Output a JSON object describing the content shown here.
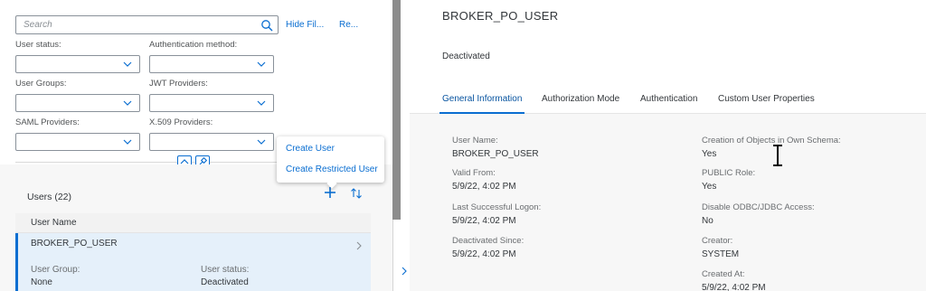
{
  "filter": {
    "search_placeholder": "Search",
    "hide_filters": "Hide Fil...",
    "restore": "Re...",
    "fields": [
      {
        "label": "User status:",
        "value": ""
      },
      {
        "label": "Authentication method:",
        "value": ""
      },
      {
        "label": "User Groups:",
        "value": ""
      },
      {
        "label": "JWT Providers:",
        "value": ""
      },
      {
        "label": "SAML Providers:",
        "value": ""
      },
      {
        "label": "X.509 Providers:",
        "value": ""
      }
    ]
  },
  "popover": {
    "items": [
      "Create User",
      "Create Restricted User"
    ]
  },
  "list": {
    "title": "Users (22)",
    "column_header": "User Name",
    "rows": [
      {
        "name": "BROKER_PO_USER",
        "group_label": "User Group:",
        "group_value": "None",
        "status_label": "User status:",
        "status_value": "Deactivated"
      }
    ]
  },
  "detail": {
    "title": "BROKER_PO_USER",
    "status": "Deactivated",
    "tabs": [
      "General Information",
      "Authorization Mode",
      "Authentication",
      "Custom User Properties"
    ],
    "active_tab": "General Information",
    "left_fields": [
      {
        "label": "User Name:",
        "value": "BROKER_PO_USER"
      },
      {
        "label": "Valid From:",
        "value": "5/9/22, 4:02 PM"
      },
      {
        "label": "Last Successful Logon:",
        "value": "5/9/22, 4:02 PM"
      },
      {
        "label": "Deactivated Since:",
        "value": "5/9/22, 4:02 PM"
      }
    ],
    "right_fields": [
      {
        "label": "Creation of Objects in Own Schema:",
        "value": "Yes"
      },
      {
        "label": "PUBLIC Role:",
        "value": "Yes"
      },
      {
        "label": "Disable ODBC/JDBC Access:",
        "value": "No"
      },
      {
        "label": "Creator:",
        "value": "SYSTEM"
      },
      {
        "label": "Created At:",
        "value": "5/9/22, 4:02 PM"
      }
    ]
  },
  "colors": {
    "accent": "#0a6ed1",
    "selected_row": "#e5f0fa",
    "splitter": "#8c8c8c"
  },
  "icons": [
    "search-icon",
    "chevron-down-icon",
    "collapse-up-icon",
    "pin-icon",
    "plus-icon",
    "sort-icon",
    "chevron-right-icon",
    "text-cursor-icon"
  ]
}
